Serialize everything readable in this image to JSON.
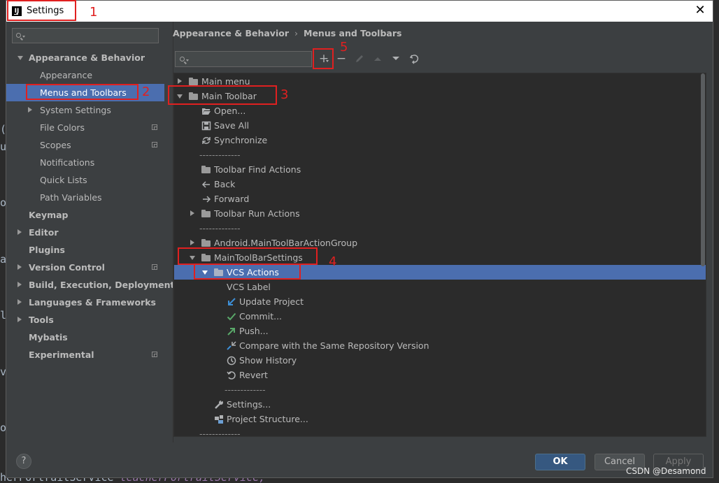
{
  "window": {
    "title": "Settings"
  },
  "sidebar": {
    "items": [
      {
        "label": "Appearance & Behavior",
        "level": 0,
        "bold": true,
        "expanded": true
      },
      {
        "label": "Appearance",
        "level": 1
      },
      {
        "label": "Menus and Toolbars",
        "level": 1,
        "selected": true
      },
      {
        "label": "System Settings",
        "level": 1,
        "collapsed": true
      },
      {
        "label": "File Colors",
        "level": 1,
        "project_icon": true
      },
      {
        "label": "Scopes",
        "level": 1,
        "project_icon": true
      },
      {
        "label": "Notifications",
        "level": 1
      },
      {
        "label": "Quick Lists",
        "level": 1
      },
      {
        "label": "Path Variables",
        "level": 1
      },
      {
        "label": "Keymap",
        "level": 0,
        "bold": true
      },
      {
        "label": "Editor",
        "level": 0,
        "bold": true,
        "collapsed": true
      },
      {
        "label": "Plugins",
        "level": 0,
        "bold": true
      },
      {
        "label": "Version Control",
        "level": 0,
        "bold": true,
        "collapsed": true,
        "project_icon": true
      },
      {
        "label": "Build, Execution, Deployment",
        "level": 0,
        "bold": true,
        "collapsed": true
      },
      {
        "label": "Languages & Frameworks",
        "level": 0,
        "bold": true,
        "collapsed": true
      },
      {
        "label": "Tools",
        "level": 0,
        "bold": true,
        "collapsed": true
      },
      {
        "label": "Mybatis",
        "level": 0,
        "bold": true
      },
      {
        "label": "Experimental",
        "level": 0,
        "bold": true,
        "project_icon": true
      }
    ]
  },
  "breadcrumb": {
    "parent": "Appearance & Behavior",
    "sep": "›",
    "current": "Menus and Toolbars"
  },
  "toolbar": {
    "add": "+",
    "remove": "−"
  },
  "tree": {
    "rows": [
      {
        "label": "Main menu",
        "indent": 0,
        "arrow": "right",
        "icon": "folder"
      },
      {
        "label": "Main Toolbar",
        "indent": 0,
        "arrow": "down",
        "icon": "folder"
      },
      {
        "label": "Open...",
        "indent": 1,
        "icon": "open"
      },
      {
        "label": "Save All",
        "indent": 1,
        "icon": "save"
      },
      {
        "label": "Synchronize",
        "indent": 1,
        "icon": "sync"
      },
      {
        "label": "-------------",
        "indent": 1,
        "separator": true
      },
      {
        "label": "Toolbar Find Actions",
        "indent": 1,
        "icon": "folder"
      },
      {
        "label": "Back",
        "indent": 1,
        "icon": "back"
      },
      {
        "label": "Forward",
        "indent": 1,
        "icon": "forward"
      },
      {
        "label": "Toolbar Run Actions",
        "indent": 1,
        "arrow": "right",
        "icon": "folder"
      },
      {
        "label": "-------------",
        "indent": 1,
        "separator": true
      },
      {
        "label": "Android.MainToolBarActionGroup",
        "indent": 1,
        "arrow": "right",
        "icon": "folder"
      },
      {
        "label": "MainToolBarSettings",
        "indent": 1,
        "arrow": "down",
        "icon": "folder"
      },
      {
        "label": "VCS Actions",
        "indent": 2,
        "arrow": "down",
        "icon": "folder",
        "selected": true
      },
      {
        "label": "VCS Label",
        "indent": 3
      },
      {
        "label": "Update Project",
        "indent": 3,
        "icon": "update"
      },
      {
        "label": "Commit...",
        "indent": 3,
        "icon": "commit"
      },
      {
        "label": "Push...",
        "indent": 3,
        "icon": "push"
      },
      {
        "label": "Compare with the Same Repository Version",
        "indent": 3,
        "icon": "compare"
      },
      {
        "label": "Show History",
        "indent": 3,
        "icon": "history"
      },
      {
        "label": "Revert",
        "indent": 3,
        "icon": "revert"
      },
      {
        "label": "-------------",
        "indent": 3,
        "separator": true
      },
      {
        "label": "Settings...",
        "indent": 2,
        "icon": "wrench"
      },
      {
        "label": "Project Structure...",
        "indent": 2,
        "icon": "project-structure"
      },
      {
        "label": "-------------",
        "indent": 1,
        "separator": true
      }
    ]
  },
  "buttons": {
    "help": "?",
    "ok": "OK",
    "cancel": "Cancel",
    "apply": "Apply"
  },
  "annotations": [
    "1",
    "2",
    "3",
    "4",
    "5"
  ],
  "background_code": {
    "text": "herPortraitService ",
    "highlight": "teacherPortraitService;"
  },
  "watermark": "CSDN @Desamond",
  "colors": {
    "selection": "#4b6eaf",
    "annotation": "#e02020",
    "ok_button": "#365880",
    "panel": "#3c3f41",
    "tree_bg": "#2b2b2b"
  }
}
